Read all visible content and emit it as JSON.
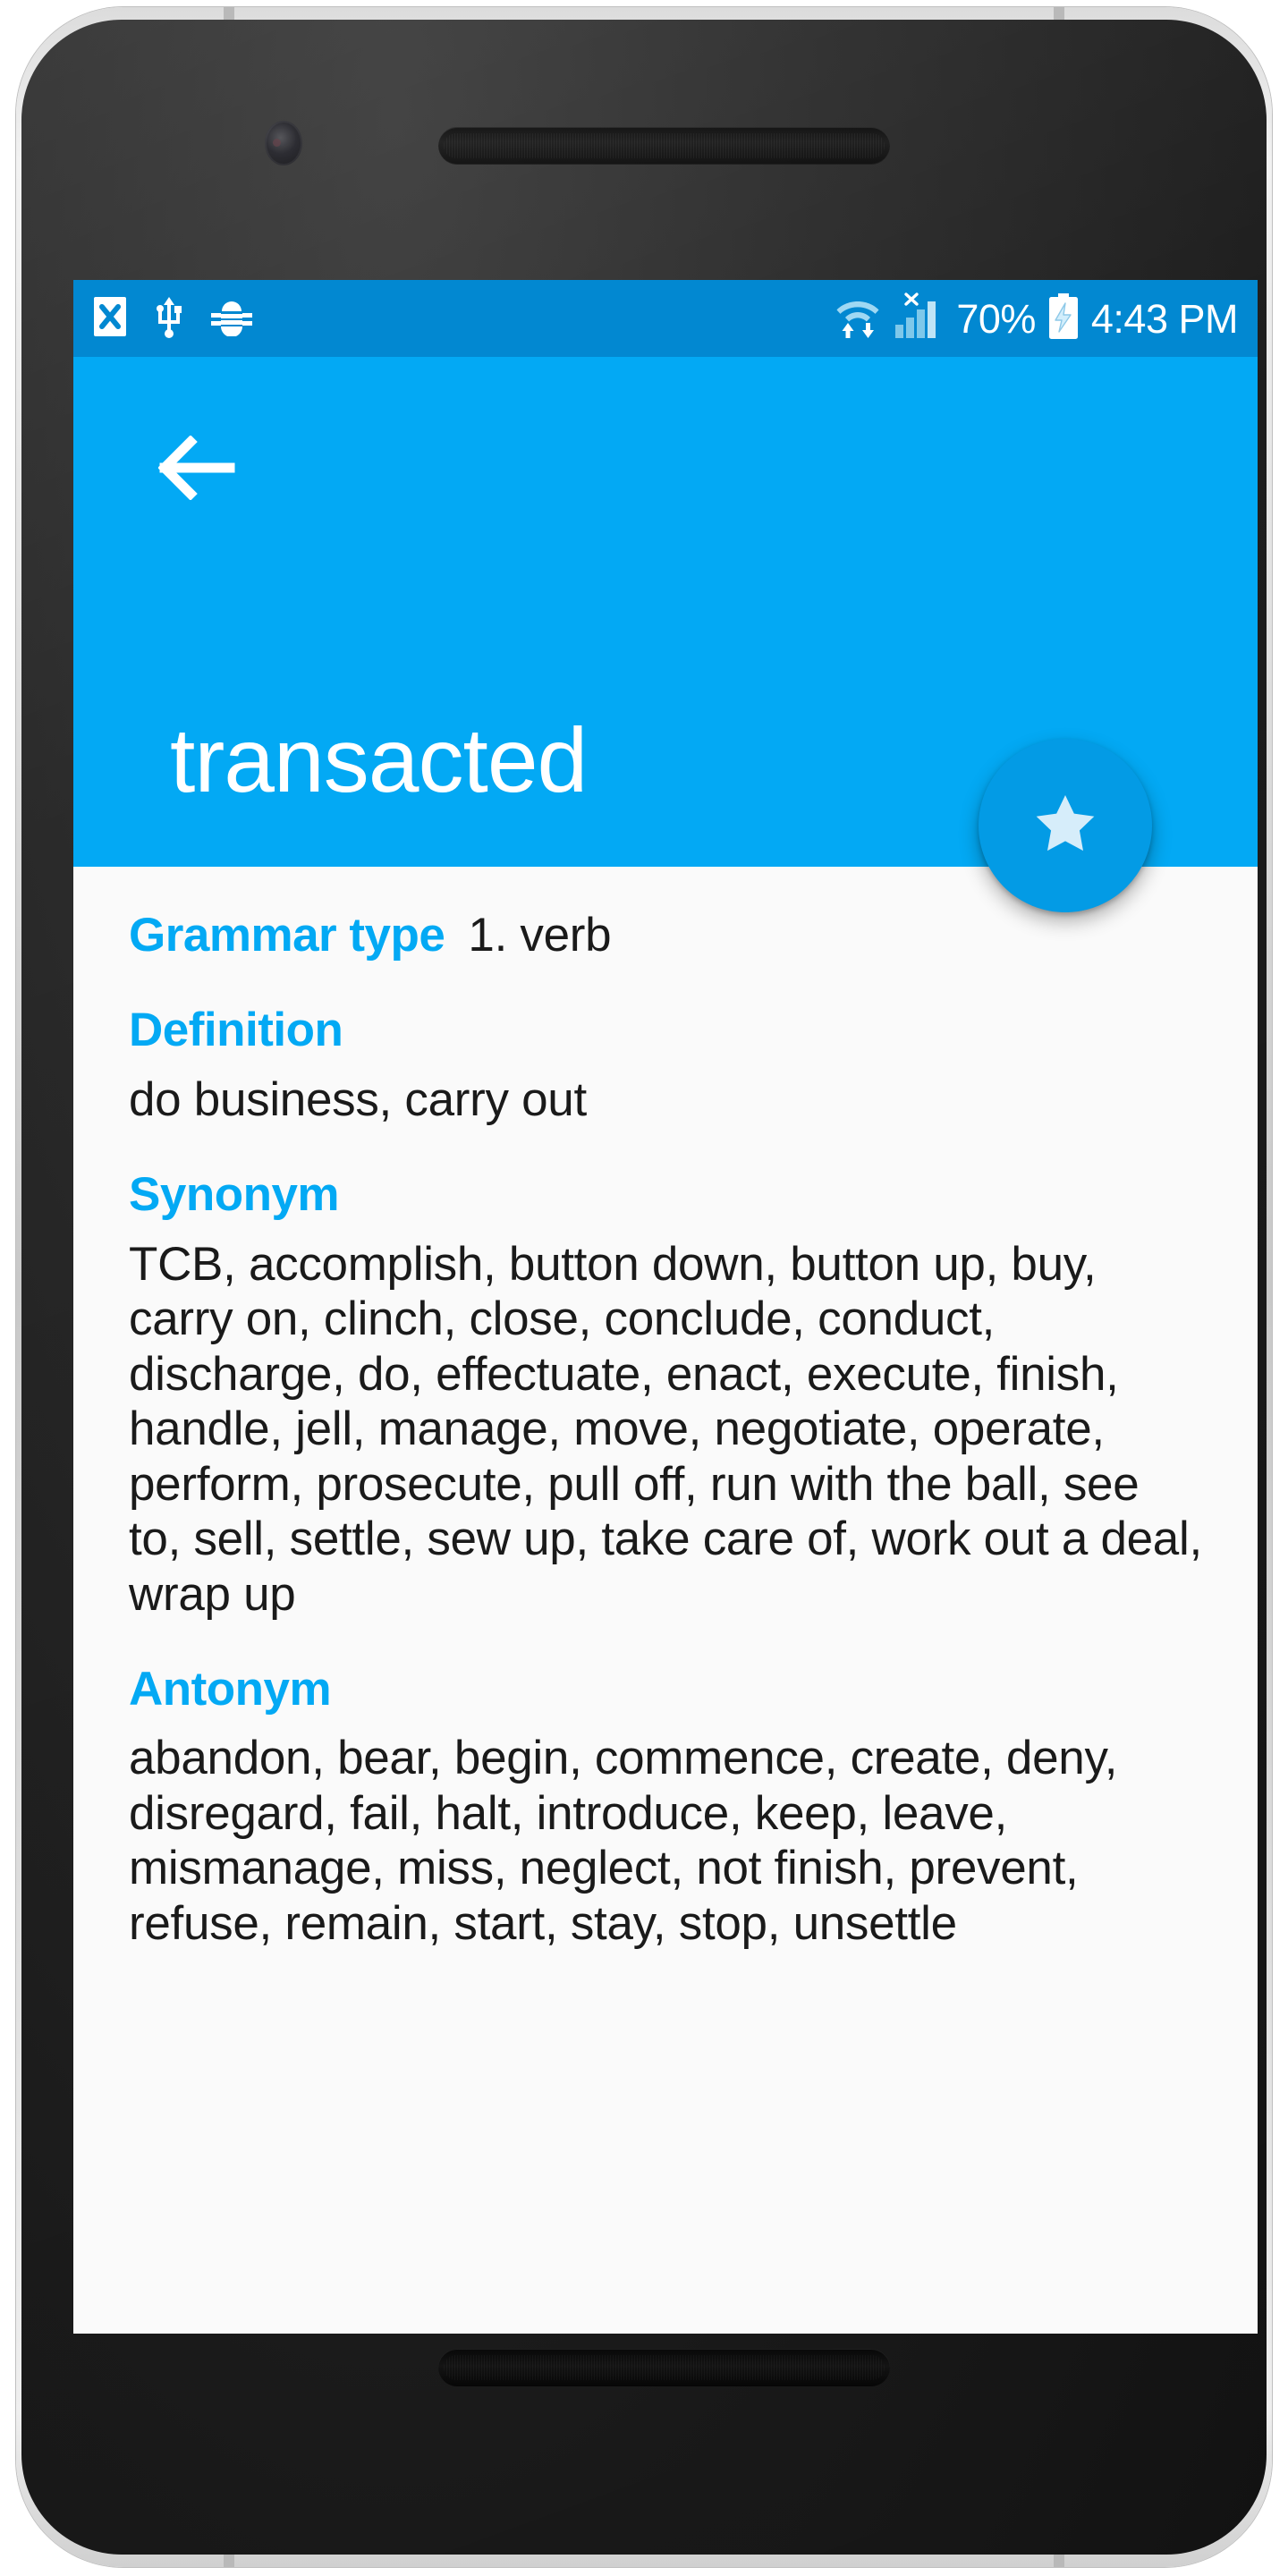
{
  "status_bar": {
    "icons_left": [
      "sim-x-icon",
      "usb-icon",
      "android-debug-bug-icon"
    ],
    "icons_right": [
      "wifi-transfer-icon",
      "signal-no-service-icon",
      "battery-charging-icon"
    ],
    "battery_percent": "70%",
    "clock": "4:43 PM"
  },
  "app_bar": {
    "back_icon": "arrow-back-icon",
    "title": "transacted",
    "color": "#03a9f4"
  },
  "fab": {
    "icon": "star-icon",
    "color": "#039be5",
    "label": "Favorite"
  },
  "content": {
    "grammar_type": {
      "label": "Grammar type",
      "value": "1. verb"
    },
    "definition": {
      "label": "Definition",
      "value": "do business, carry out"
    },
    "synonym": {
      "label": "Synonym",
      "value": "TCB, accomplish, button down, button up, buy, carry on, clinch, close, conclude, conduct, discharge, do, effectuate, enact, execute, finish, handle, jell, manage, move, negotiate, operate, perform, prosecute, pull off, run with the ball, see to, sell, settle, sew up, take care of, work out a deal, wrap up"
    },
    "antonym": {
      "label": "Antonym",
      "value": "abandon, bear, begin, commence, create, deny, disregard, fail, halt, introduce, keep, leave, mismanage, miss, neglect, not finish, prevent, refuse, remain, start, stay, stop, unsettle"
    }
  },
  "theme": {
    "accent": "#03a9f4",
    "status_bar_bg": "#0288d1",
    "content_bg": "#fafafa",
    "text": "#1a1a1a"
  }
}
